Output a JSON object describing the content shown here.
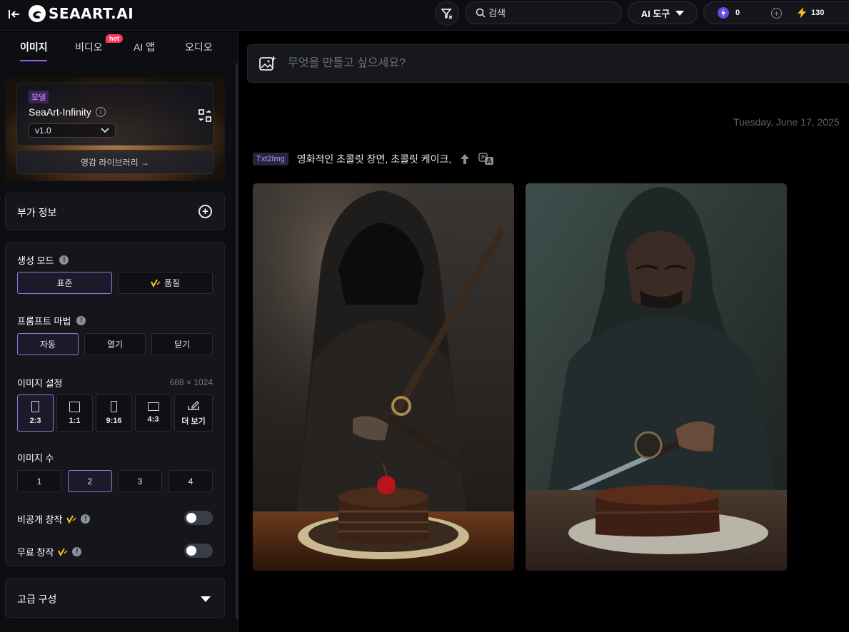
{
  "header": {
    "logo_text": "SEAART.AI",
    "search_placeholder": "검색",
    "ai_tool_label": "AI 도구",
    "credit_energy": "0",
    "credit_stamina": "130"
  },
  "sidebar": {
    "tabs": [
      {
        "label": "이미지",
        "active": true
      },
      {
        "label": "비디오",
        "active": false
      },
      {
        "label": "AI 앱",
        "active": false
      },
      {
        "label": "오디오",
        "active": false
      }
    ],
    "hot_badge": "hot",
    "model": {
      "tag": "모델",
      "name": "SeaArt-Infinity",
      "version": "v1.0",
      "library_label": "영감 라이브러리 →"
    },
    "extra_info_label": "부가 정보",
    "generation_mode": {
      "title": "생성 모드",
      "options": [
        "표준",
        "품질"
      ],
      "selected": "표준"
    },
    "prompt_magic": {
      "title": "프롬프트 마법",
      "options": [
        "자동",
        "열기",
        "닫기"
      ],
      "selected": "자동"
    },
    "image_settings": {
      "title": "이미지 설정",
      "size": "688 × 1024",
      "ratios": [
        "2:3",
        "1:1",
        "9:16",
        "4:3",
        "더 보기"
      ],
      "selected": "2:3"
    },
    "image_count": {
      "title": "이미지 수",
      "options": [
        "1",
        "2",
        "3",
        "4"
      ],
      "selected": "2"
    },
    "private_label": "비공개 창작",
    "private_on": false,
    "free_label": "무료 창작",
    "free_on": false,
    "advanced_label": "고급 구성"
  },
  "main": {
    "prompt_placeholder": "무엇을 만들고 싶으세요?",
    "date": "Tuesday, June 17, 2025",
    "task": {
      "badge": "Txt2Img",
      "prompt": "영화적인 초콜릿 장면, 초콜릿 케이크,"
    }
  },
  "colors": {
    "accent": "#8d7ad6",
    "tag_purple": "#d592ff",
    "hot_red": "#ff3b5c"
  }
}
